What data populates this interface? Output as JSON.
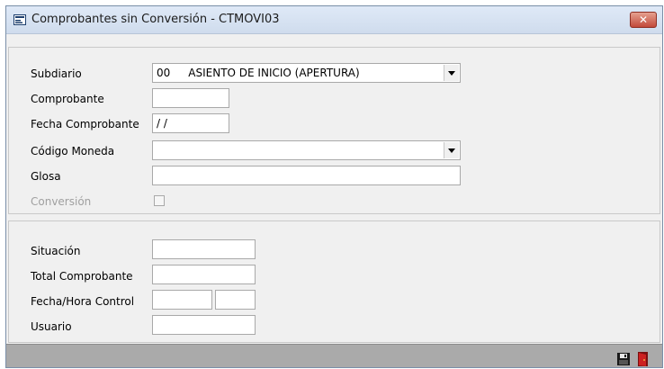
{
  "window": {
    "title": "Comprobantes sin Conversión - CTMOVI03",
    "close_icon": "close-icon"
  },
  "form": {
    "subdiario": {
      "label": "Subdiario",
      "code": "00",
      "value": "ASIENTO DE INICIO (APERTURA)"
    },
    "comprobante": {
      "label": "Comprobante",
      "value": ""
    },
    "fecha_comprobante": {
      "label": "Fecha Comprobante",
      "value": " / /"
    },
    "codigo_moneda": {
      "label": "Código Moneda",
      "value": ""
    },
    "glosa": {
      "label": "Glosa",
      "value": ""
    },
    "conversion": {
      "label": "Conversión",
      "checked": false,
      "enabled": false
    }
  },
  "control": {
    "situacion": {
      "label": "Situación",
      "value": ""
    },
    "total_comprobante": {
      "label": "Total Comprobante",
      "value": ""
    },
    "fecha_hora_control": {
      "label": "Fecha/Hora Control",
      "fecha": "",
      "hora": ""
    },
    "usuario": {
      "label": "Usuario",
      "value": ""
    }
  },
  "toolbar": {
    "save_icon": "floppy-disk-icon",
    "exit_icon": "exit-door-icon",
    "colors": {
      "save": "#1a1a1a",
      "exit": "#cc2020"
    }
  }
}
